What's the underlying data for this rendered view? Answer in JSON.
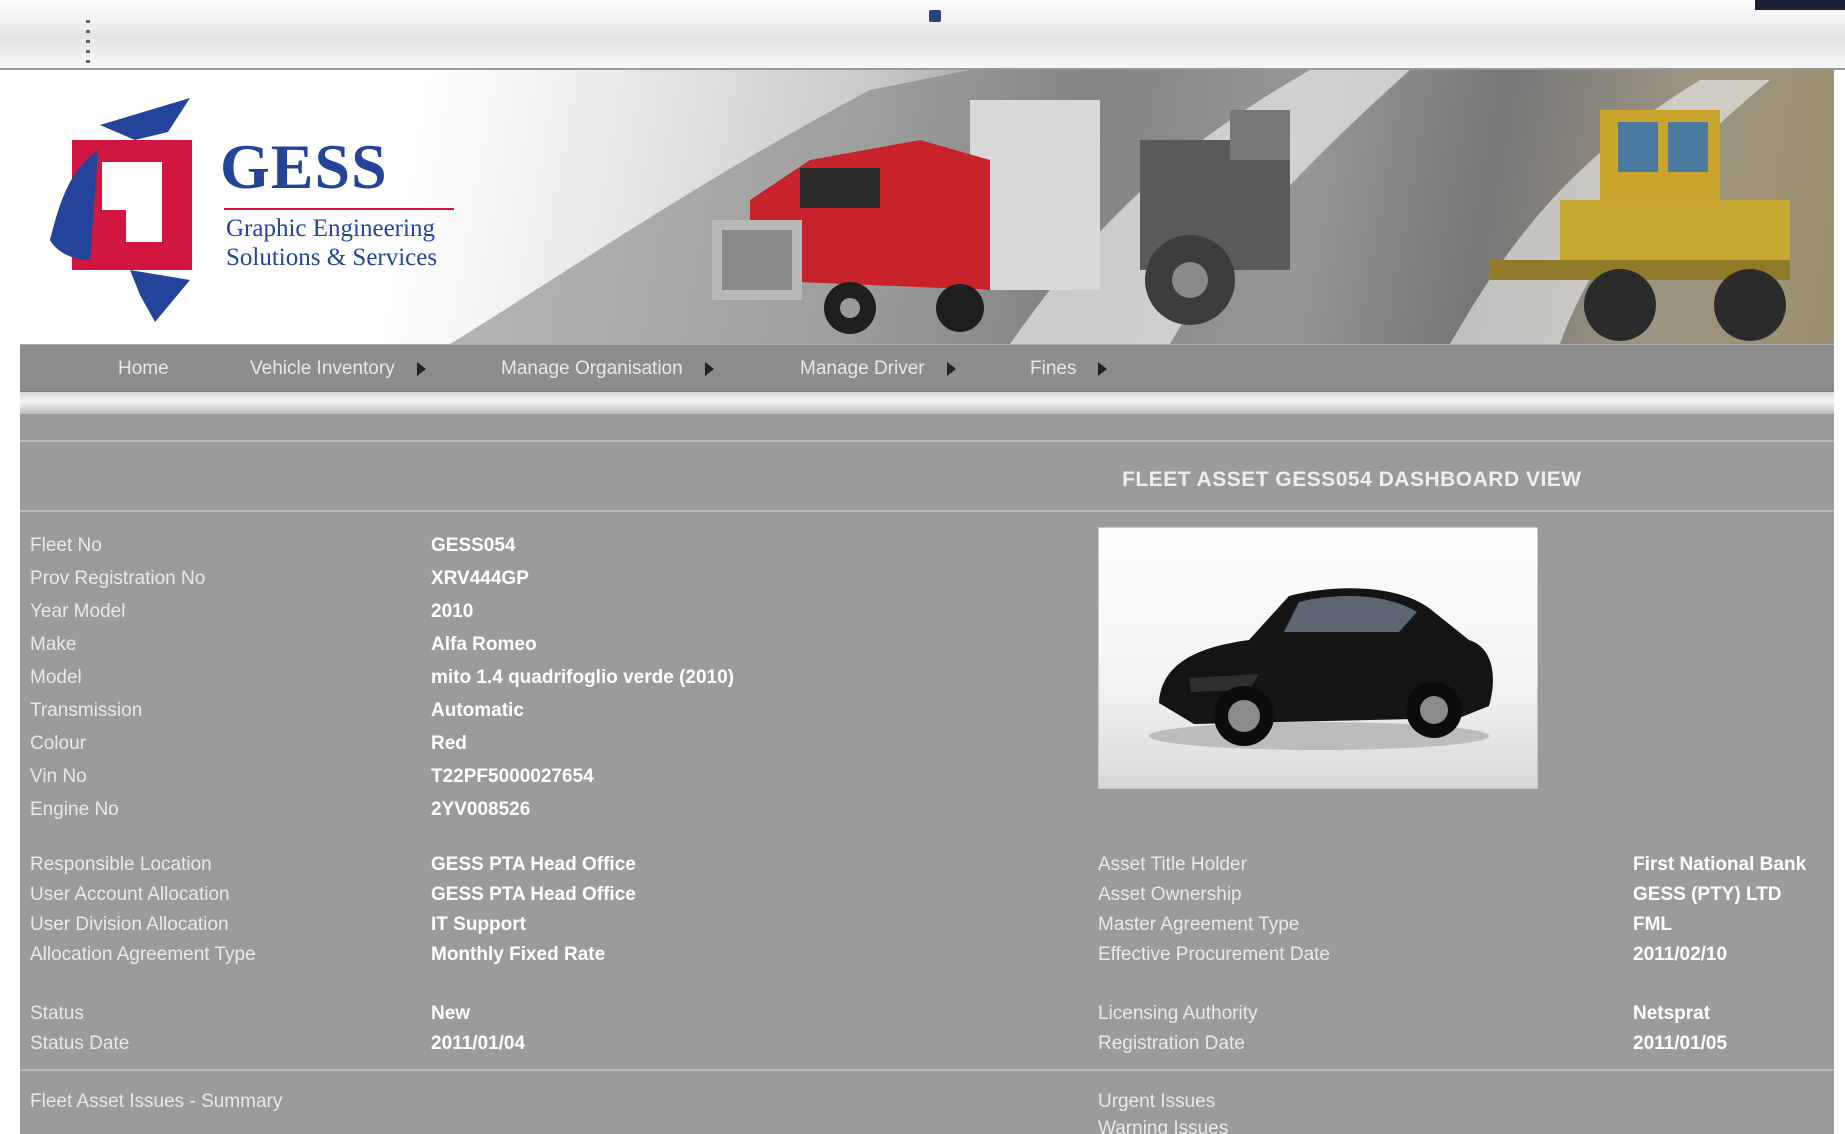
{
  "nav": {
    "items": [
      {
        "label": "Home",
        "has_submenu": false
      },
      {
        "label": "Vehicle Inventory",
        "has_submenu": true
      },
      {
        "label": "Manage Organisation",
        "has_submenu": true
      },
      {
        "label": "Manage Driver",
        "has_submenu": true
      },
      {
        "label": "Fines",
        "has_submenu": true
      }
    ]
  },
  "logo": {
    "name": "GESS",
    "tagline_line1": "Graphic Engineering",
    "tagline_line2": "Solutions & Services"
  },
  "dashboard": {
    "title": "FLEET ASSET GESS054 DASHBOARD VIEW"
  },
  "vehicle": [
    {
      "label": "Fleet No",
      "value": "GESS054"
    },
    {
      "label": "Prov Registration No",
      "value": "XRV444GP"
    },
    {
      "label": "Year Model",
      "value": "2010"
    },
    {
      "label": "Make",
      "value": "Alfa Romeo"
    },
    {
      "label": "Model",
      "value": "mito 1.4 quadrifoglio verde (2010)"
    },
    {
      "label": "Transmission",
      "value": "Automatic"
    },
    {
      "label": "Colour",
      "value": "Red"
    },
    {
      "label": "Vin No",
      "value": "T22PF5000027654"
    },
    {
      "label": "Engine No",
      "value": "2YV008526"
    }
  ],
  "allocation": {
    "left": [
      {
        "label": "Responsible Location",
        "value": "GESS PTA Head Office"
      },
      {
        "label": "User Account Allocation",
        "value": "GESS PTA Head Office"
      },
      {
        "label": "User Division Allocation",
        "value": "IT Support"
      },
      {
        "label": "Allocation Agreement Type",
        "value": "Monthly Fixed Rate"
      }
    ],
    "right": [
      {
        "label": "Asset Title Holder",
        "value": "First National Bank"
      },
      {
        "label": "Asset Ownership",
        "value": "GESS (PTY) LTD"
      },
      {
        "label": "Master Agreement Type",
        "value": "FML"
      },
      {
        "label": "Effective Procurement Date",
        "value": "2011/02/10"
      }
    ]
  },
  "status": {
    "left": [
      {
        "label": "Status",
        "value": "New"
      },
      {
        "label": "Status Date",
        "value": "2011/01/04"
      }
    ],
    "right": [
      {
        "label": "Licensing Authority",
        "value": "Netsprat"
      },
      {
        "label": "Registration Date",
        "value": "2011/01/05"
      }
    ]
  },
  "issues": {
    "summary_label": "Fleet Asset Issues - Summary",
    "urgent_label": "Urgent Issues",
    "warning_label": "Warning Issues"
  },
  "colors": {
    "panel_bg": "#9b9b9b",
    "nav_bg": "#8d8d8d",
    "logo_blue": "#24439a",
    "logo_red": "#d1163f",
    "truck_red": "#c8232b"
  }
}
